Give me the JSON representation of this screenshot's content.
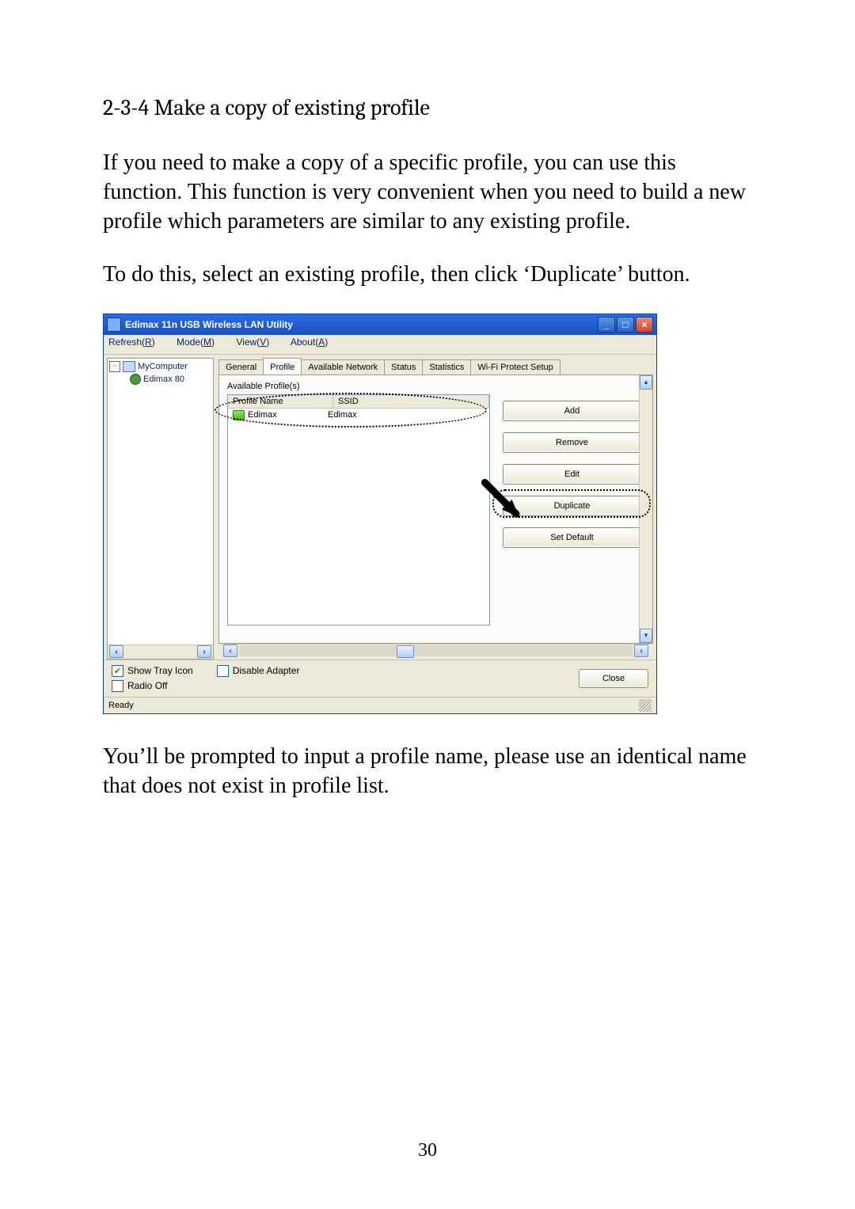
{
  "doc": {
    "heading": "2-3-4 Make a copy of existing profile",
    "para1": "If you need to make a copy of a specific profile, you can use this function. This function is very convenient when you need to build a new profile which parameters are similar to any existing profile.",
    "para2": "To do this, select an existing profile, then click ‘Duplicate’ button.",
    "para3": "You’ll be prompted to input a profile name, please use an identical name that does not exist in profile list.",
    "page_number": "30"
  },
  "app": {
    "title": "Edimax 11n USB Wireless LAN Utility",
    "menus": {
      "refresh": "Refresh(R)",
      "mode": "Mode(M)",
      "view": "View(V)",
      "about": "About(A)"
    },
    "tree": {
      "root": "MyComputer",
      "child": "Edimax 80"
    },
    "tabs": {
      "general": "General",
      "profile": "Profile",
      "available": "Available Network",
      "status": "Status",
      "statistics": "Statistics",
      "wps": "Wi-Fi Protect Setup"
    },
    "section_label": "Available Profile(s)",
    "columns": {
      "name": "Profile Name",
      "ssid": "SSID"
    },
    "profile_row": {
      "name": "Edimax",
      "ssid": "Edimax"
    },
    "buttons": {
      "add": "Add",
      "remove": "Remove",
      "edit": "Edit",
      "duplicate": "Duplicate",
      "set_default": "Set Default",
      "close": "Close"
    },
    "checks": {
      "show_tray": "Show Tray Icon",
      "disable_adapter": "Disable Adapter",
      "radio_off": "Radio Off"
    },
    "status_text": "Ready"
  }
}
